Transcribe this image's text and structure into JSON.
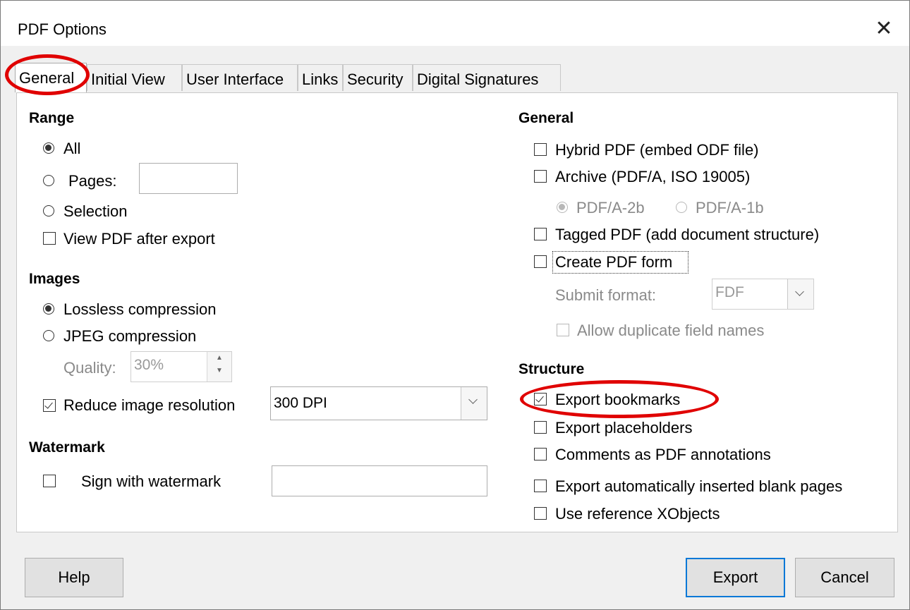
{
  "window": {
    "title": "PDF Options",
    "close_glyph": "✕"
  },
  "tabs": [
    "General",
    "Initial View",
    "User Interface",
    "Links",
    "Security",
    "Digital Signatures"
  ],
  "range": {
    "heading": "Range",
    "all": "All",
    "pages": "Pages:",
    "selection": "Selection",
    "view_pdf": "View PDF after export",
    "pages_value": ""
  },
  "images": {
    "heading": "Images",
    "lossless": "Lossless compression",
    "jpeg": "JPEG compression",
    "quality_label": "Quality:",
    "quality_value": "30%",
    "reduce": "Reduce image resolution",
    "dpi": "300 DPI"
  },
  "watermark": {
    "heading": "Watermark",
    "sign": "Sign with watermark",
    "value": ""
  },
  "general": {
    "heading": "General",
    "hybrid": "Hybrid PDF (embed ODF file)",
    "archive": "Archive (PDF/A, ISO 19005)",
    "pdfa2b": "PDF/A-2b",
    "pdfa1b": "PDF/A-1b",
    "tagged": "Tagged PDF (add document structure)",
    "create_form": "Create PDF form",
    "submit_label": "Submit format:",
    "submit_value": "FDF",
    "allow_dup": "Allow duplicate field names"
  },
  "structure": {
    "heading": "Structure",
    "bookmarks": "Export bookmarks",
    "placeholders": "Export placeholders",
    "comments": "Comments as PDF annotations",
    "blank_pages": "Export automatically inserted blank pages",
    "xobjects": "Use reference XObjects"
  },
  "buttons": {
    "help": "Help",
    "export": "Export",
    "cancel": "Cancel"
  },
  "colors": {
    "annotation": "#e00000",
    "default_button_border": "#0078d7"
  }
}
